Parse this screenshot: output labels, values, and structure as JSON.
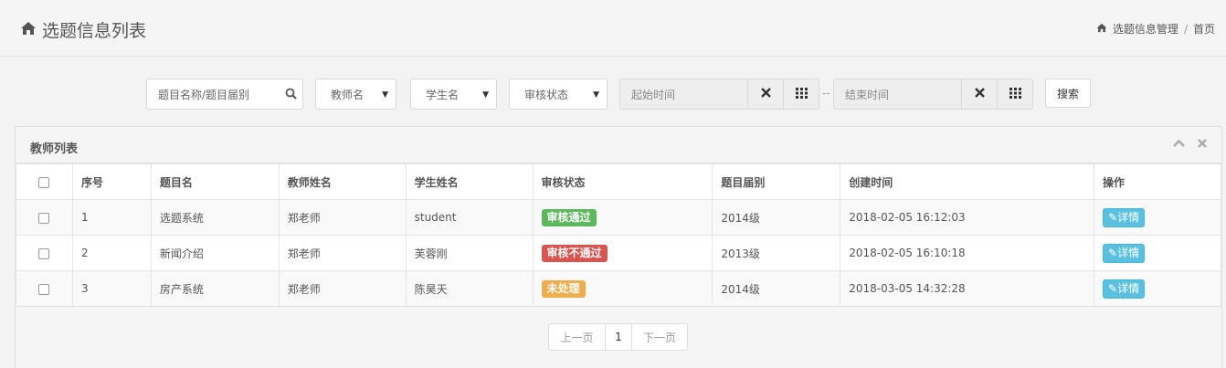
{
  "header": {
    "title": "选题信息列表",
    "breadcrumb": [
      "选题信息管理",
      "首页"
    ]
  },
  "filters": {
    "search_placeholder": "题目名称/题目届别",
    "teacher_select": "教师名",
    "student_select": "学生名",
    "status_select": "审核状态",
    "start_time_placeholder": "起始时间",
    "end_time_placeholder": "结束时间",
    "separator": "--",
    "search_button": "搜索"
  },
  "panel": {
    "title": "教师列表",
    "columns": [
      "序号",
      "题目名",
      "教师姓名",
      "学生姓名",
      "审核状态",
      "题目届别",
      "创建时间",
      "操作"
    ],
    "rows": [
      {
        "no": "1",
        "topic": "选题系统",
        "teacher": "郑老师",
        "student": "student",
        "status": "审核通过",
        "status_color": "#5cb85c",
        "grade": "2014级",
        "created": "2018-02-05 16:12:03",
        "action": "详情"
      },
      {
        "no": "2",
        "topic": "新闻介绍",
        "teacher": "郑老师",
        "student": "芙蓉刚",
        "status": "审核不通过",
        "status_color": "#d9534f",
        "grade": "2013级",
        "created": "2018-02-05 16:10:18",
        "action": "详情"
      },
      {
        "no": "3",
        "topic": "房产系统",
        "teacher": "郑老师",
        "student": "陈昊天",
        "status": "未处理",
        "status_color": "#f0ad4e",
        "grade": "2014级",
        "created": "2018-03-05 14:32:28",
        "action": "详情"
      }
    ]
  },
  "pagination": {
    "prev": "上一页",
    "page": "1",
    "next": "下一页"
  },
  "icons": {
    "home": "home-icon",
    "search": "search-icon",
    "clear": "clear-icon",
    "calendar": "calendar-icon",
    "collapse": "chevron-up-icon",
    "close": "close-icon",
    "edit": "pencil-icon"
  }
}
